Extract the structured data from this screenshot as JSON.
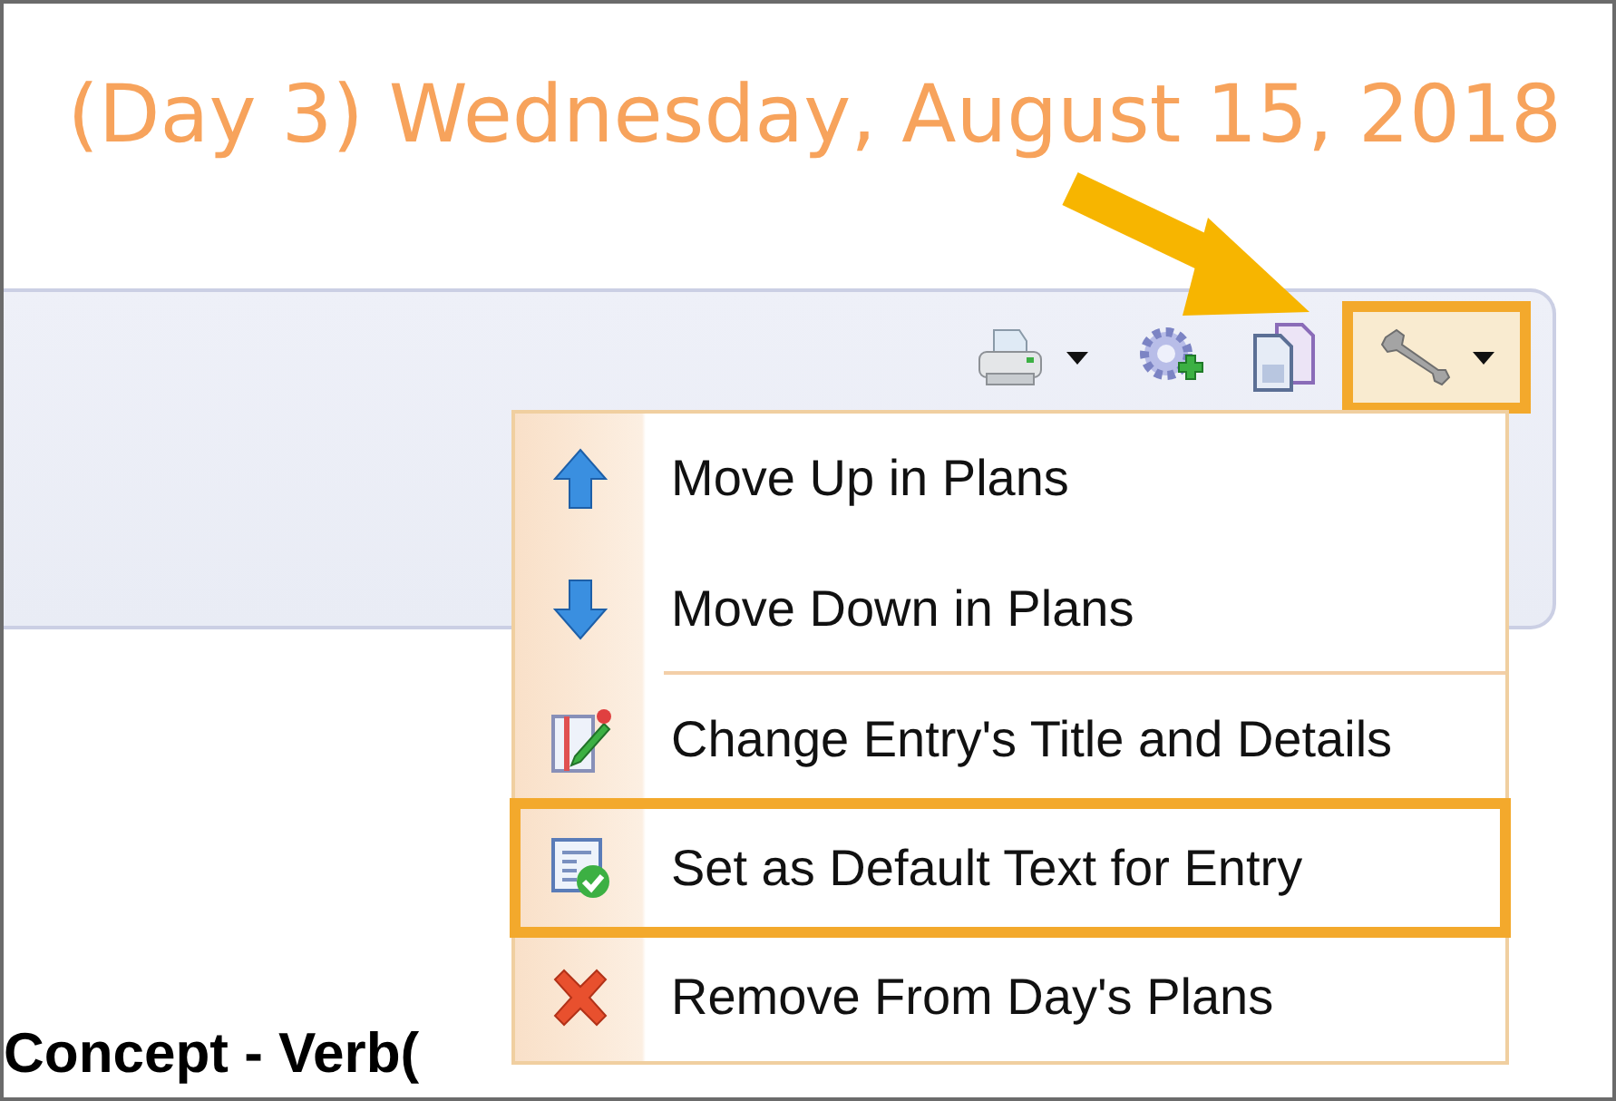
{
  "title": "(Day 3) Wednesday, August 15, 2018",
  "toolbar": [
    {
      "kind": "print",
      "dropdown": true,
      "highlighted": false
    },
    {
      "kind": "add-settings",
      "dropdown": false,
      "highlighted": false
    },
    {
      "kind": "copy",
      "dropdown": false,
      "highlighted": false
    },
    {
      "kind": "tools",
      "dropdown": true,
      "highlighted": true
    }
  ],
  "menu": [
    {
      "kind": "move-up",
      "label": "Move Up in Plans",
      "highlighted": false,
      "separator_after": false
    },
    {
      "kind": "move-down",
      "label": "Move Down in Plans",
      "highlighted": false,
      "separator_after": true
    },
    {
      "kind": "edit",
      "label": "Change Entry's Title and Details",
      "highlighted": false,
      "separator_after": false
    },
    {
      "kind": "set-default",
      "label": "Set as Default Text for Entry",
      "highlighted": true,
      "separator_after": false
    },
    {
      "kind": "remove",
      "label": "Remove From Day's Plans",
      "highlighted": false,
      "separator_after": false
    }
  ],
  "heading": "Concept - Verb("
}
